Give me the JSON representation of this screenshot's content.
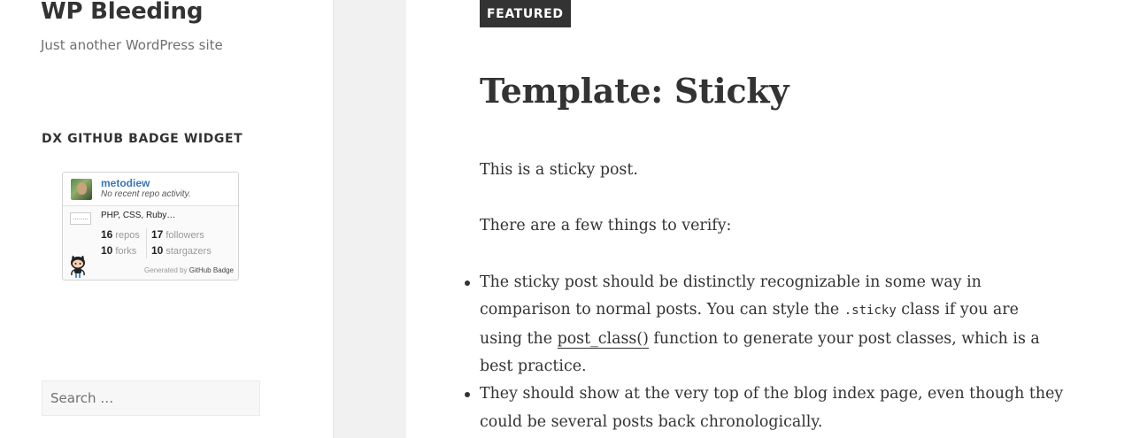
{
  "site": {
    "title": "WP Bleeding",
    "description": "Just another WordPress site"
  },
  "widget": {
    "title": "DX GITHUB BADGE WIDGET",
    "badge": {
      "username": "metodiew",
      "activity": "No recent repo activity.",
      "repo_placeholder": "........",
      "languages": "PHP, CSS, Ruby…",
      "stats": {
        "repos": {
          "value": "16",
          "label": "repos"
        },
        "forks": {
          "value": "10",
          "label": "forks"
        },
        "followers": {
          "value": "17",
          "label": "followers"
        },
        "stargazers": {
          "value": "10",
          "label": "stargazers"
        }
      },
      "footer_prefix": "Generated by",
      "footer_link": "GitHub Badge"
    }
  },
  "search": {
    "placeholder": "Search …"
  },
  "post": {
    "badge": "FEATURED",
    "title": "Template: Sticky",
    "paragraphs": [
      "This is a sticky post.",
      "There are a few things to verify:"
    ],
    "bullets": [
      {
        "before_code": "The sticky post should be distinctly recognizable in some way in comparison to normal posts. You can style the ",
        "code": ".sticky",
        "between": " class if you are using the ",
        "link": "post_class()",
        "after": " function to generate your post classes, which is a best practice."
      },
      {
        "text": "They should show at the very top of the blog index page, even though they could be several posts back chronologically."
      }
    ]
  },
  "icons": {
    "avatar": "avatar-icon",
    "octocat": "octocat-icon"
  },
  "colors": {
    "sidebar_bg": "#ffffff",
    "page_bg": "#f1f1f1",
    "text": "#333333",
    "badge_user": "#3b75b8",
    "featured_bg": "#333333"
  }
}
